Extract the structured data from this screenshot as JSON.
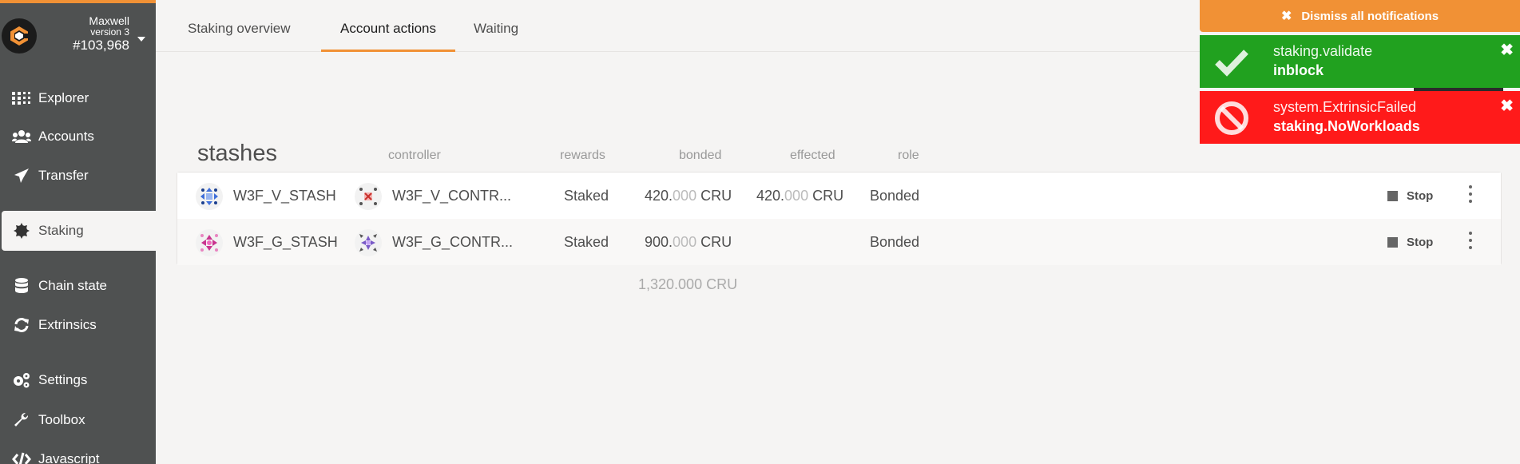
{
  "chain": {
    "name": "Maxwell",
    "version": "version 3",
    "block": "#103,968"
  },
  "sidebar": {
    "items": [
      {
        "label": "Explorer",
        "icon": "grid-icon"
      },
      {
        "label": "Accounts",
        "icon": "users-icon"
      },
      {
        "label": "Transfer",
        "icon": "paper-plane-icon"
      },
      {
        "label": "Staking",
        "icon": "certificate-icon"
      },
      {
        "label": "Chain state",
        "icon": "database-icon"
      },
      {
        "label": "Extrinsics",
        "icon": "sync-icon"
      },
      {
        "label": "Settings",
        "icon": "cogs-icon"
      },
      {
        "label": "Toolbox",
        "icon": "wrench-icon"
      },
      {
        "label": "Javascript",
        "icon": "code-icon"
      }
    ]
  },
  "tabs": [
    {
      "label": "Staking overview"
    },
    {
      "label": "Account actions"
    },
    {
      "label": "Waiting"
    }
  ],
  "table": {
    "title": "stashes",
    "headers": {
      "controller": "controller",
      "rewards": "rewards",
      "bonded": "bonded",
      "effected": "effected",
      "role": "role"
    },
    "rows": [
      {
        "stash": "W3F_V_STASH",
        "controller": "W3F_V_CONTR...",
        "rewards": "Staked",
        "bonded_int": "420.",
        "bonded_dec": "000",
        "bonded_unit": " CRU",
        "effected_int": "420.",
        "effected_dec": "000",
        "effected_unit": " CRU",
        "role": "Bonded",
        "action": "Stop"
      },
      {
        "stash": "W3F_G_STASH",
        "controller": "W3F_G_CONTR...",
        "rewards": "Staked",
        "bonded_int": "900.",
        "bonded_dec": "000",
        "bonded_unit": " CRU",
        "effected_int": "",
        "effected_dec": "",
        "effected_unit": "",
        "role": "Bonded",
        "action": "Stop"
      }
    ],
    "total": "1,320.000 CRU"
  },
  "notifications": {
    "dismiss_all": "Dismiss all notifications",
    "items": [
      {
        "type": "success",
        "title": "staking.validate",
        "status": "inblock"
      },
      {
        "type": "error",
        "title": "system.ExtrinsicFailed",
        "status": "staking.NoWorkloads"
      }
    ]
  },
  "colors": {
    "accent": "#f19135",
    "sidebar": "#4f5151",
    "success": "#21a11f",
    "error": "#ff1a1a"
  }
}
